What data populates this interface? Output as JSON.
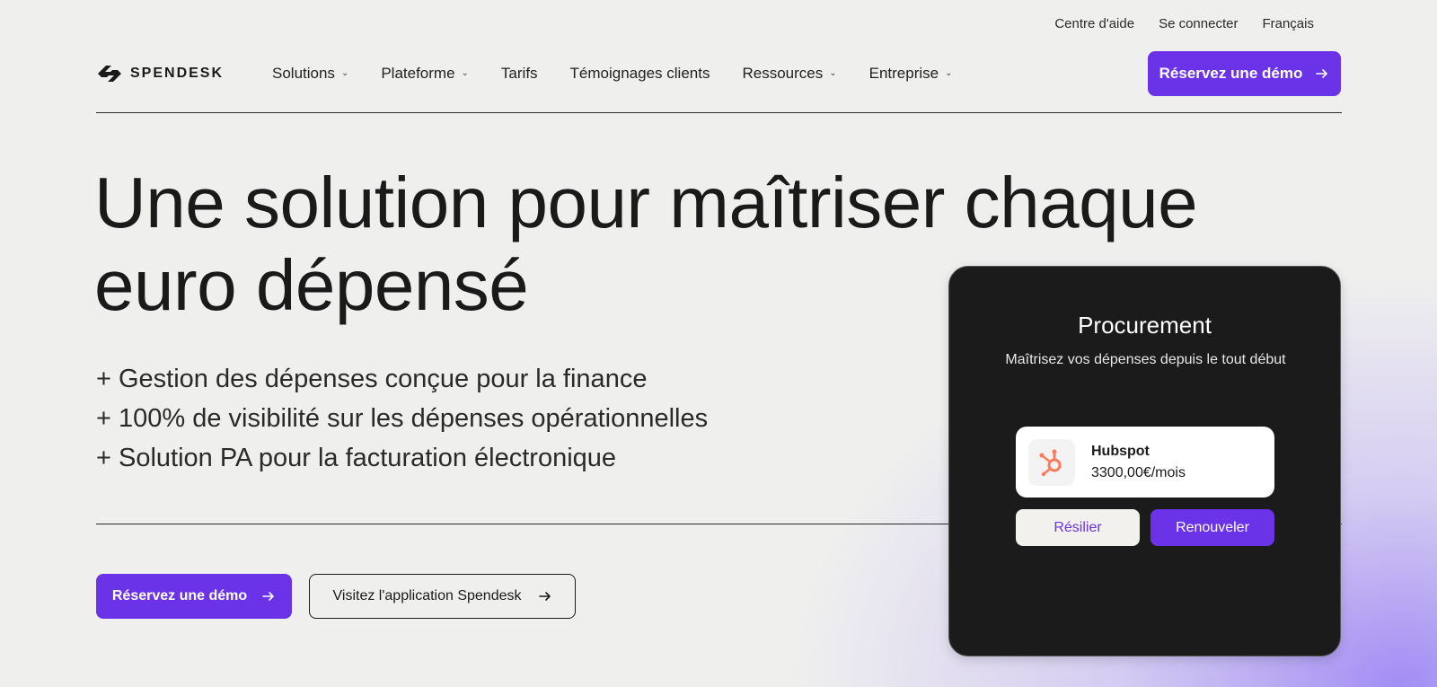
{
  "topbar": {
    "help": "Centre d'aide",
    "login": "Se connecter",
    "language": "Français"
  },
  "brand": {
    "name": "SPENDESK"
  },
  "nav": {
    "items": [
      {
        "label": "Solutions",
        "dropdown": true
      },
      {
        "label": "Plateforme",
        "dropdown": true
      },
      {
        "label": "Tarifs",
        "dropdown": false
      },
      {
        "label": "Témoignages clients",
        "dropdown": false
      },
      {
        "label": "Ressources",
        "dropdown": true
      },
      {
        "label": "Entreprise",
        "dropdown": true
      }
    ],
    "cta": "Réservez une démo"
  },
  "hero": {
    "title_line1": "Une solution pour maîtriser chaque",
    "title_line2": "euro dépensé",
    "bullets": [
      "+ Gestion des dépenses conçue pour la finance",
      "+ 100% de visibilité sur les dépenses opérationnelles",
      "+ Solution PA pour la facturation électronique"
    ],
    "cta_primary": "Réservez une démo",
    "cta_secondary": "Visitez l'application Spendesk"
  },
  "card": {
    "title": "Procurement",
    "subtitle": "Maîtrisez vos dépenses depuis le tout début",
    "item": {
      "name": "Hubspot",
      "price": "3300,00€/mois",
      "icon": "hubspot-logo"
    },
    "btn_cancel": "Résilier",
    "btn_renew": "Renouveler"
  },
  "colors": {
    "accent": "#6b33e8",
    "card_bg": "#1b1b1b",
    "hubspot": "#ff7a59"
  }
}
